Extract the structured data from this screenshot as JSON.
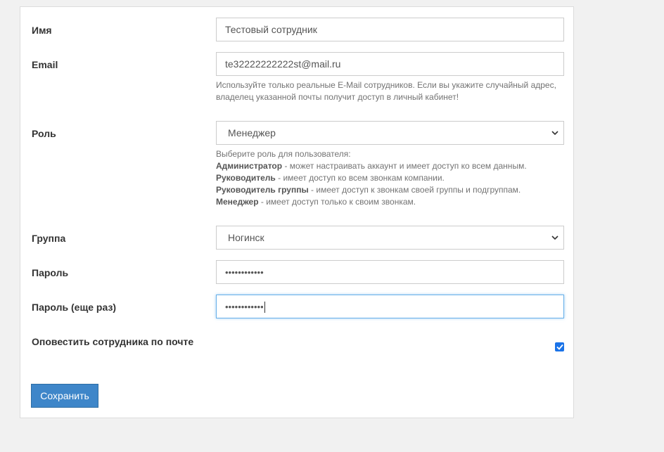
{
  "form": {
    "name": {
      "label": "Имя",
      "value": "Тестовый сотрудник"
    },
    "email": {
      "label": "Email",
      "value": "te32222222222st@mail.ru",
      "help": "Используйте только реальные E-Mail сотрудников. Если вы укажите случайный адрес, владелец указанной почты получит доступ в личный кабинет!"
    },
    "role": {
      "label": "Роль",
      "value": "Менеджер",
      "help_intro": "Выберите роль для пользователя:",
      "help_items": [
        {
          "title": "Администратор",
          "text": " - может настраивать аккаунт и имеет доступ ко всем данным."
        },
        {
          "title": "Руководитель",
          "text": " - имеет доступ ко всем звонкам компании."
        },
        {
          "title": "Руководитель группы",
          "text": " - имеет доступ к звонкам своей группы и подгруппам."
        },
        {
          "title": "Менеджер",
          "text": " - имеет доступ только к своим звонкам."
        }
      ]
    },
    "group": {
      "label": "Группа",
      "value": "Ногинск"
    },
    "password": {
      "label": "Пароль",
      "value": "••••••••••••"
    },
    "password_repeat": {
      "label": "Пароль (еще раз)",
      "value": "••••••••••••"
    },
    "notify": {
      "label": "Оповестить сотрудника по почте",
      "checked": true
    },
    "save_label": "Сохранить"
  },
  "colors": {
    "accent": "#3e86c9",
    "checkbox": "#1a73e8",
    "focus_border": "#66afe9"
  },
  "icons": {
    "select_arrow": "chevron-down-icon",
    "checkbox_mark": "check-icon"
  }
}
